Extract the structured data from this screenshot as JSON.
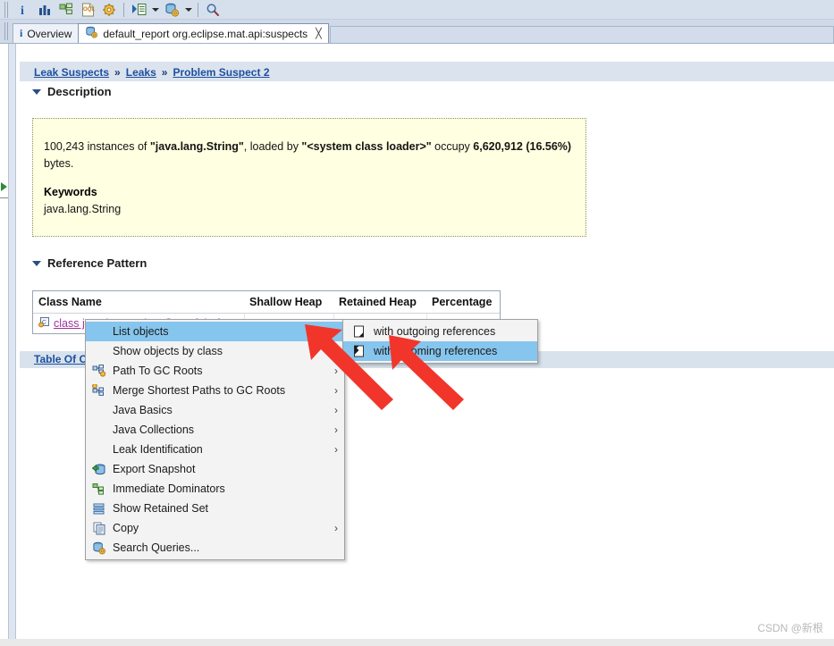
{
  "toolbar": {
    "items": [
      {
        "name": "info-icon",
        "glyph": "i"
      },
      {
        "name": "histogram-icon",
        "glyph": "bars"
      },
      {
        "name": "dominator-tree-icon",
        "glyph": "tree"
      },
      {
        "name": "oql-icon",
        "glyph": "oql"
      },
      {
        "name": "queries-gear-icon",
        "glyph": "gear"
      },
      {
        "name": "run-expression-icon",
        "glyph": "run"
      },
      {
        "name": "open-query-browser-icon",
        "glyph": "db-gear"
      },
      {
        "name": "search-icon",
        "glyph": "magnifier"
      }
    ]
  },
  "tabs": [
    {
      "label": "Overview",
      "icon": "info-icon",
      "active": false,
      "closable": false
    },
    {
      "label": "default_report  org.eclipse.mat.api:suspects",
      "icon": "report-icon",
      "active": true,
      "closable": true
    }
  ],
  "breadcrumb": {
    "items": [
      "Leak Suspects",
      "Leaks",
      "Problem Suspect 2"
    ],
    "separator": "»"
  },
  "sections": {
    "description": {
      "title": "Description",
      "paragraph_prefix": "100,243 instances of ",
      "class_name": "\"java.lang.String\"",
      "paragraph_middle": ", loaded by ",
      "loader_name": "\"<system class loader>\"",
      "paragraph_suffix": " occupy ",
      "bytes_value": "6,620,912 (16.56%)",
      "paragraph_end": " bytes.",
      "keywords_title": "Keywords",
      "keywords_value": "java.lang.String"
    },
    "reference_pattern": {
      "title": "Reference Pattern",
      "columns": [
        "Class Name",
        "Shallow Heap",
        "Retained Heap",
        "Percentage"
      ],
      "rows": [
        {
          "class_name": "class java.lang.String @ 0x4f3b4f50",
          "shallow_heap": "",
          "retained_heap": "",
          "percentage": ""
        }
      ]
    }
  },
  "table_of_contents_link": "Table Of Contents",
  "context_menu": {
    "items": [
      {
        "label": "List objects",
        "icon": "",
        "submenu": true,
        "selected": true
      },
      {
        "label": "Show objects by class",
        "icon": "",
        "submenu": false,
        "selected": false
      },
      {
        "label": "Path To GC Roots",
        "icon": "gc-roots-icon",
        "submenu": true,
        "selected": false
      },
      {
        "label": "Merge Shortest Paths to GC Roots",
        "icon": "merge-paths-icon",
        "submenu": true,
        "selected": false
      },
      {
        "label": "Java Basics",
        "icon": "",
        "submenu": true,
        "selected": false
      },
      {
        "label": "Java Collections",
        "icon": "",
        "submenu": true,
        "selected": false
      },
      {
        "label": "Leak Identification",
        "icon": "",
        "submenu": true,
        "selected": false
      },
      {
        "label": "Export Snapshot",
        "icon": "export-snapshot-icon",
        "submenu": false,
        "selected": false
      },
      {
        "label": "Immediate Dominators",
        "icon": "immediate-dominators-icon",
        "submenu": false,
        "selected": false
      },
      {
        "label": "Show Retained Set",
        "icon": "retained-set-icon",
        "submenu": false,
        "selected": false
      },
      {
        "label": "Copy",
        "icon": "copy-icon",
        "submenu": true,
        "selected": false
      },
      {
        "label": "Search Queries...",
        "icon": "search-queries-icon",
        "submenu": false,
        "selected": false
      }
    ]
  },
  "submenu": {
    "items": [
      {
        "label": "with outgoing references",
        "icon": "outgoing-refs-icon",
        "selected": false
      },
      {
        "label": "with incoming references",
        "icon": "incoming-refs-icon",
        "selected": true
      }
    ]
  },
  "annotations": {
    "arrow_color": "#f2352b",
    "arrow_count": 2
  },
  "watermark": "CSDN @新根",
  "colors": {
    "selection_blue": "#86c5ed",
    "link_blue": "#1d4f9e",
    "class_link_magenta": "#a0329a",
    "description_bg": "#ffffe1",
    "toolbar_bg": "#d6dfec"
  }
}
